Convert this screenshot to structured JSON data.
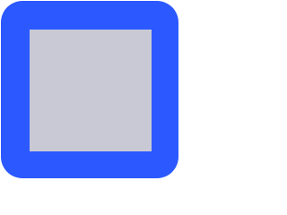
{
  "icon": {
    "name": "stop-icon",
    "frame_color": "#2b59ff",
    "inner_color": "#c9c9d6"
  }
}
